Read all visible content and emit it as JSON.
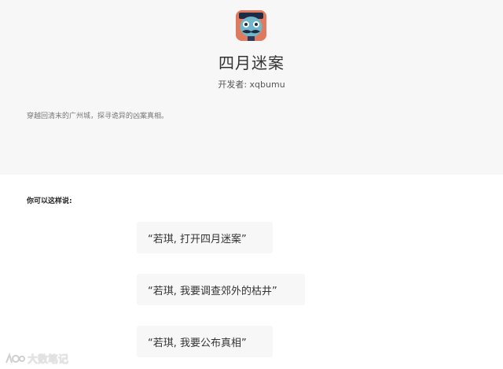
{
  "app": {
    "title": "四月迷案",
    "developer": "开发者: xqbumu",
    "description": "穿越回清末的广州城，探寻诡异的凶案真相。",
    "icon": "mustached-face-app-icon"
  },
  "examples": {
    "heading": "你可以这样说:",
    "items": [
      "“若琪, 打开四月迷案”",
      "“若琪, 我要调查郊外的枯井”",
      "“若琪, 我要公布真相”"
    ]
  },
  "watermark": {
    "text": "大数笔记"
  },
  "colors": {
    "header_bg": "#f7f7f7",
    "card_bg": "#f7f7f7",
    "icon_accent": "#e07a5f"
  }
}
